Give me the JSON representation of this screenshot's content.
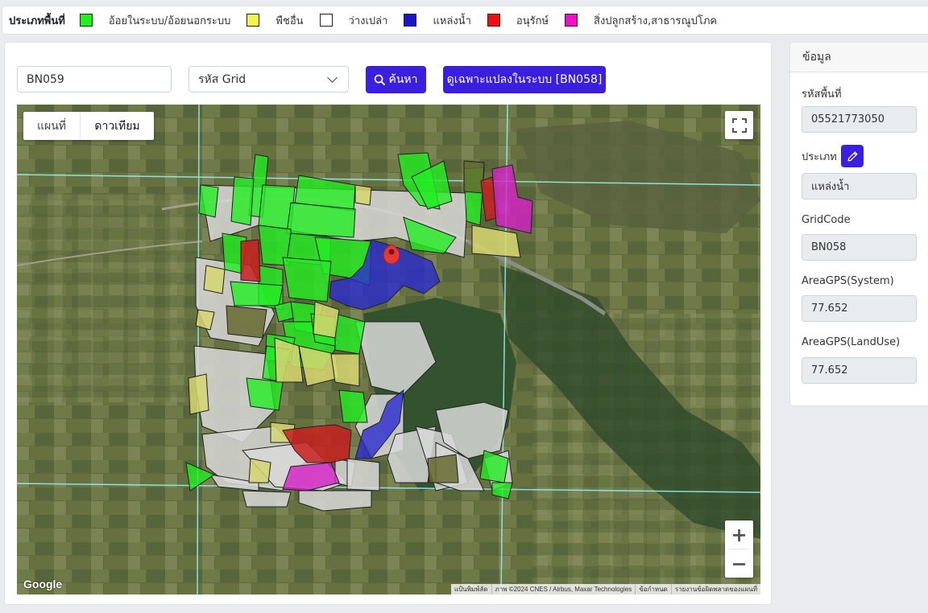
{
  "legend": {
    "title": "ประเภทพื้นที่",
    "items": [
      {
        "label": "อ้อยในระบบ/อ้อยนอกระบบ",
        "color": "#22ee22"
      },
      {
        "label": "พืชอื่น",
        "color": "#f3f348"
      },
      {
        "label": "ว่างเปล่า",
        "color": "#ffffff"
      },
      {
        "label": "แหล่งน้ำ",
        "color": "#1616c8"
      },
      {
        "label": "อนุรักษ์",
        "color": "#ee1111"
      },
      {
        "label": "สิ่งปลูกสร้าง,สาธารณูปโภค",
        "color": "#ee11c8"
      }
    ]
  },
  "search": {
    "value": "BN059",
    "grid_select": "รหัส Grid",
    "search_button": "ค้นหา",
    "view_button": "ดูเฉพาะแปลงในระบบ [BN058]"
  },
  "map": {
    "type_map": "แผนที่",
    "type_satellite": "ดาวเทียม",
    "zoom_in": "+",
    "zoom_out": "−",
    "google": "Google",
    "attribution": [
      "แป้นพิมพ์ลัด",
      "ภาพ ©2024 CNES / Airbus, Maxar Technologies",
      "ข้อกำหนด",
      "รายงานข้อผิดพลาดของแผนที่"
    ]
  },
  "info": {
    "header": "ข้อมูล",
    "fields": [
      {
        "label": "รหัสพื้นที่",
        "value": "05521773050"
      },
      {
        "label": "ประเภท",
        "value": "แหล่งน้ำ"
      },
      {
        "label": "GridCode",
        "value": "BN058"
      },
      {
        "label": "AreaGPS(System)",
        "value": "77.652"
      },
      {
        "label": "AreaGPS(LandUse)",
        "value": "77.652"
      }
    ]
  },
  "icons": [
    "search-icon",
    "chevron-down-icon",
    "fullscreen-icon",
    "pencil-icon",
    "map-pin-icon"
  ]
}
